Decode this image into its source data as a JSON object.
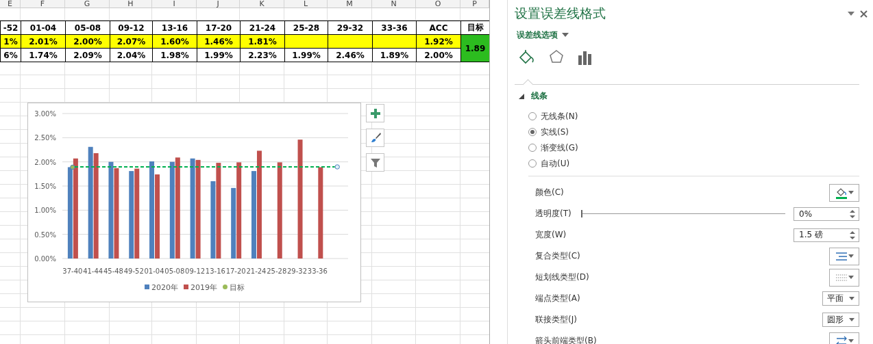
{
  "sheet": {
    "columns": [
      "E",
      "F",
      "G",
      "H",
      "I",
      "J",
      "K",
      "L",
      "M",
      "N",
      "O",
      "P"
    ],
    "header_row": [
      "-52",
      "01-04",
      "05-08",
      "09-12",
      "13-16",
      "17-20",
      "21-24",
      "25-28",
      "29-32",
      "33-36",
      "ACC",
      "目标"
    ],
    "rows": [
      {
        "highlighted": true,
        "cells": [
          "1%",
          "2.01%",
          "2.00%",
          "2.07%",
          "1.60%",
          "1.46%",
          "1.81%",
          null,
          null,
          null,
          "1.92%"
        ]
      },
      {
        "highlighted": false,
        "cells": [
          "6%",
          "1.74%",
          "2.09%",
          "2.04%",
          "1.98%",
          "1.99%",
          "2.23%",
          "1.99%",
          "2.46%",
          "1.89%",
          "2.00%"
        ]
      }
    ],
    "target_value": "1.89"
  },
  "chart": {
    "chart_data": {
      "type": "bar",
      "categories": [
        "37-40",
        "41-44",
        "45-48",
        "49-52",
        "01-04",
        "05-08",
        "09-12",
        "13-16",
        "17-20",
        "21-24",
        "25-28",
        "29-32",
        "33-36"
      ],
      "series": [
        {
          "name": "2020年",
          "color": "#4f81bd",
          "values": [
            1.89,
            2.31,
            2.0,
            1.81,
            2.01,
            2.0,
            2.07,
            1.6,
            1.46,
            1.81,
            null,
            null,
            null
          ]
        },
        {
          "name": "2019年",
          "color": "#c0504d",
          "values": [
            2.07,
            2.18,
            1.87,
            1.86,
            1.74,
            2.09,
            2.04,
            1.98,
            1.99,
            2.23,
            1.99,
            2.46,
            1.89
          ]
        },
        {
          "name": "目标",
          "color": "#9bbb59",
          "type": "scatter",
          "values": [
            1.89,
            null,
            null,
            null,
            null,
            null,
            null,
            null,
            null,
            null,
            null,
            null,
            null
          ]
        }
      ],
      "grid": true,
      "legend": true,
      "ylim": [
        0,
        3
      ],
      "yticks": [
        {
          "value": 0,
          "label": "0.00%"
        },
        {
          "value": 0.5,
          "label": "0.50%"
        },
        {
          "value": 1,
          "label": "1.00%"
        },
        {
          "value": 1.5,
          "label": "1.50%"
        },
        {
          "value": 2,
          "label": "2.00%"
        },
        {
          "value": 2.5,
          "label": "2.50%"
        },
        {
          "value": 3,
          "label": "3.00%"
        }
      ]
    }
  },
  "panel": {
    "title": "设置误差线格式",
    "options_menu": "误差线选项",
    "tabs": [
      {
        "kind": "fill",
        "selected": true
      },
      {
        "kind": "effects",
        "selected": false
      },
      {
        "kind": "options",
        "selected": false
      }
    ],
    "section": {
      "title": "线条",
      "expanded": true
    },
    "radios": [
      {
        "label": "无线条(N)",
        "selected": false
      },
      {
        "label": "实线(S)",
        "selected": true
      },
      {
        "label": "渐变线(G)",
        "selected": false
      },
      {
        "label": "自动(U)",
        "selected": false
      }
    ],
    "properties": [
      {
        "kind": "color",
        "label": "颜色(C)"
      },
      {
        "kind": "slider",
        "label": "透明度(T)",
        "level": 0,
        "value": "0%"
      },
      {
        "kind": "spinner",
        "label": "宽度(W)",
        "value": "1.5 磅"
      },
      {
        "kind": "compound",
        "label": "复合类型(C)"
      },
      {
        "kind": "dash",
        "label": "短划线类型(D)"
      },
      {
        "kind": "select",
        "label": "端点类型(A)",
        "value": "平面"
      },
      {
        "kind": "select",
        "label": "联接类型(J)",
        "value": "圆形"
      },
      {
        "kind": "arrow",
        "label": "箭头前端类型(B)"
      }
    ]
  }
}
